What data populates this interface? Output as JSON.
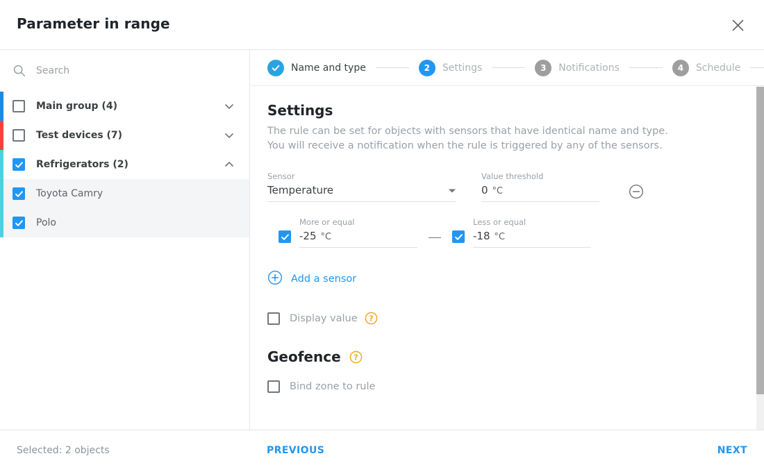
{
  "dialog": {
    "title": "Parameter in range",
    "close_icon": "close-icon"
  },
  "sidebar": {
    "search": {
      "placeholder": "Search",
      "value": "",
      "icon": "search-icon"
    },
    "tree": [
      {
        "label": "Main group (4)",
        "checked": false,
        "type": "group",
        "expanded": false,
        "bar_color": "#1e88e5",
        "chevron": "chevron-down-icon"
      },
      {
        "label": "Test devices (7)",
        "checked": false,
        "type": "group",
        "expanded": false,
        "bar_color": "#f4433b",
        "chevron": "chevron-down-icon"
      },
      {
        "label": "Refrigerators (2)",
        "checked": true,
        "type": "group",
        "expanded": true,
        "bar_color": "#4dd0e1",
        "chevron": "chevron-up-icon"
      },
      {
        "label": "Toyota Camry",
        "checked": true,
        "type": "child",
        "bar_color": "#4dd0e1"
      },
      {
        "label": "Polo",
        "checked": true,
        "type": "child",
        "bar_color": "#4dd0e1"
      }
    ]
  },
  "stepper": [
    {
      "number": "1",
      "label": "Name and type",
      "state": "done"
    },
    {
      "number": "2",
      "label": "Settings",
      "state": "active"
    },
    {
      "number": "3",
      "label": "Notifications",
      "state": "todo"
    },
    {
      "number": "4",
      "label": "Schedule",
      "state": "todo"
    }
  ],
  "settings": {
    "heading": "Settings",
    "description_line1": "The rule can be set for objects with sensors that have identical name and type.",
    "description_line2": "You will receive a notification when the rule is triggered by any of the sensors.",
    "sensor": {
      "label": "Sensor",
      "value": "Temperature",
      "caret_icon": "chevron-down-icon"
    },
    "threshold": {
      "label": "Value threshold",
      "value": "0",
      "unit": "°C"
    },
    "remove_icon": "minus-circle-icon",
    "more_or_equal": {
      "label": "More or equal",
      "value": "-25",
      "unit": "°C",
      "checked": true
    },
    "less_or_equal": {
      "label": "Less or equal",
      "value": "-18",
      "unit": "°C",
      "checked": true
    },
    "separator": "—",
    "add_sensor": {
      "label": "Add a sensor",
      "icon": "plus-circle-icon"
    },
    "display_value": {
      "label": "Display value",
      "checked": false,
      "help_icon": "help-circle-icon"
    }
  },
  "geofence": {
    "heading": "Geofence",
    "help_icon": "help-circle-icon",
    "bind_zone": {
      "label": "Bind zone to rule",
      "checked": false
    }
  },
  "footer": {
    "selected": "Selected: 2 objects",
    "previous": "PREVIOUS",
    "next": "NEXT"
  },
  "colors": {
    "accent": "#2196f3",
    "help": "#f5a623",
    "muted": "#9aa0a6",
    "text": "#3c4043"
  }
}
